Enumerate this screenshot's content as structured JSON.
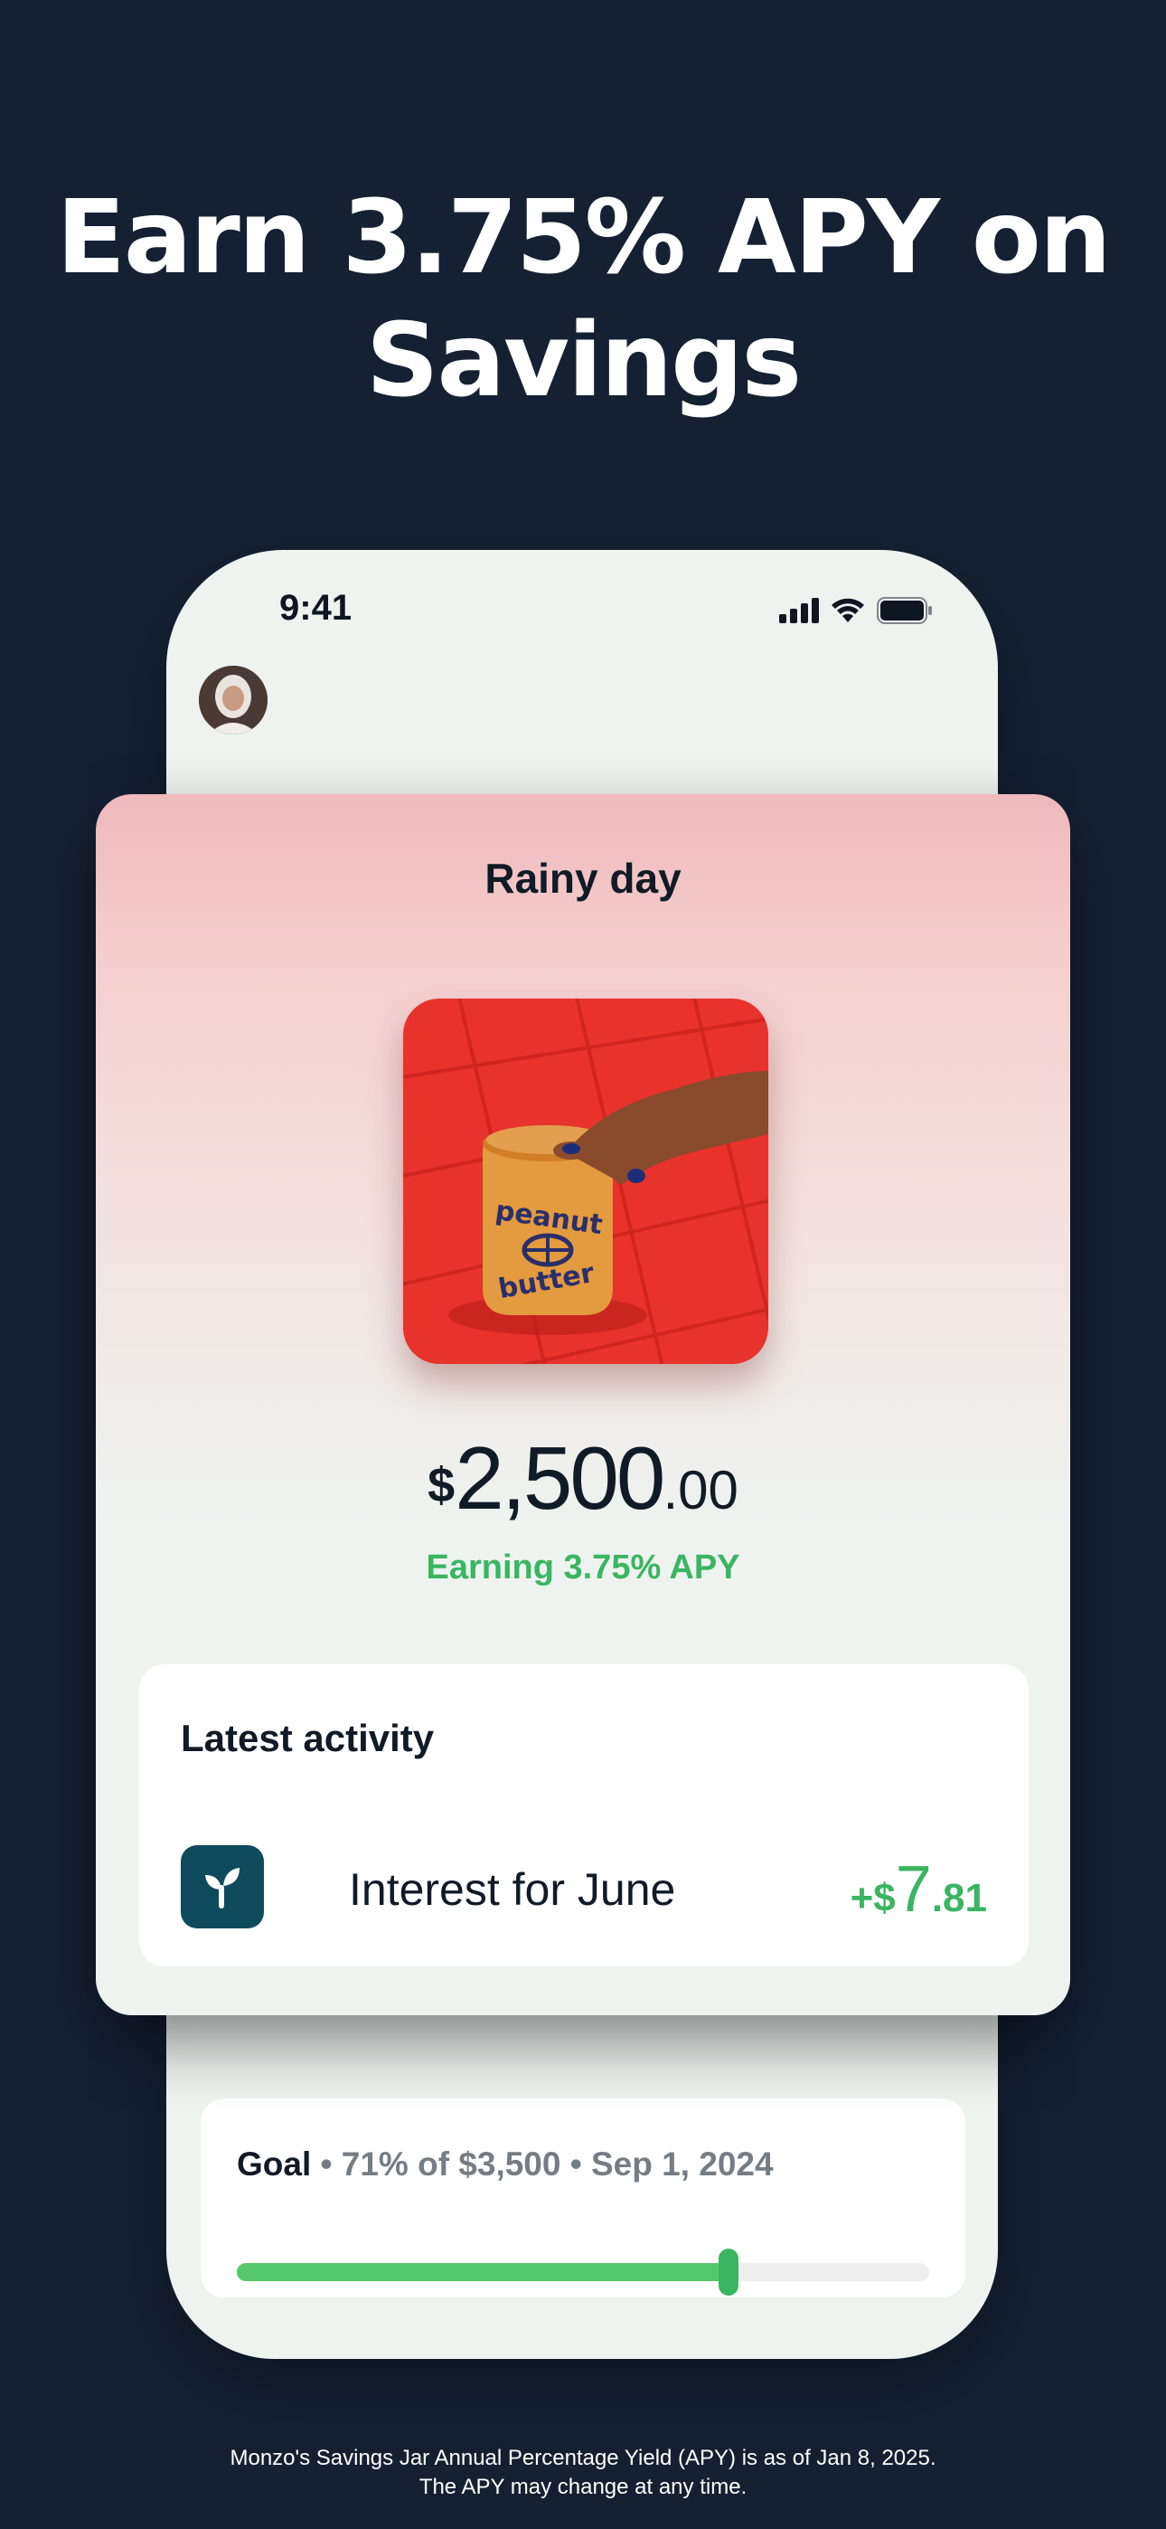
{
  "headline": {
    "line1": "Earn 3.75% APY on",
    "line2": "Savings"
  },
  "status_bar": {
    "time": "9:41"
  },
  "jar": {
    "title": "Rainy day",
    "photo_text": {
      "line1": "peanut",
      "line2": "butter"
    },
    "balance": {
      "currency": "$",
      "whole": "2,500",
      "cents": ".00"
    },
    "earning": "Earning 3.75% APY"
  },
  "activity": {
    "title": "Latest activity",
    "items": [
      {
        "label": "Interest for June",
        "amount_sign": "+$",
        "amount_whole": "7",
        "amount_cents": ".81"
      }
    ]
  },
  "goal": {
    "label": "Goal",
    "details": " • 71% of $3,500 • Sep 1, 2024",
    "progress": 0.71
  },
  "disclaimer": {
    "line1": "Monzo's Savings Jar Annual Percentage Yield (APY) is as of Jan 8, 2025.",
    "line2": "The APY may change at any time."
  },
  "colors": {
    "background": "#152133",
    "accent_green": "#3ab562",
    "tx_icon_bg": "#0d4a5c"
  },
  "icons": [
    "signal-icon",
    "wifi-icon",
    "battery-icon",
    "sprout-icon"
  ]
}
